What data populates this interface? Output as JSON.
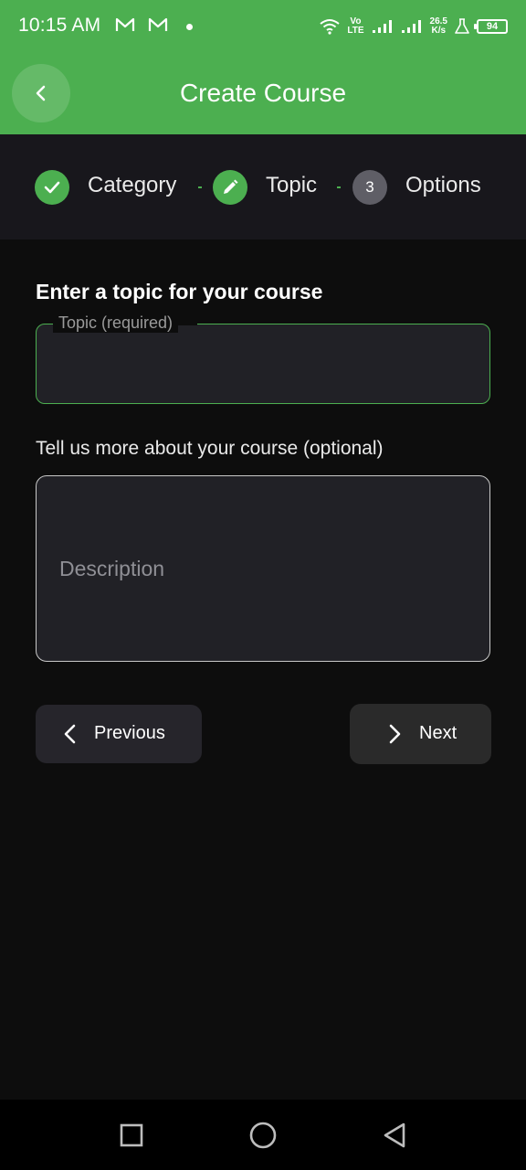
{
  "status_bar": {
    "time": "10:15 AM",
    "network_top": "Vo",
    "network_bottom": "LTE",
    "speed_value": "26.5",
    "speed_unit": "K/s",
    "battery": "94",
    "icons": [
      "gmail-icon",
      "gmail-icon",
      "notification-dot",
      "wifi-icon",
      "volte-icon",
      "signal-icon",
      "signal-icon",
      "speed-indicator",
      "flask-icon",
      "battery-icon"
    ]
  },
  "app_bar": {
    "title": "Create Course",
    "back_icon": "chevron-left-icon",
    "color": "#4caf50"
  },
  "stepper": {
    "steps": [
      {
        "label": "Category",
        "state": "completed",
        "icon": "check-icon"
      },
      {
        "label": "Topic",
        "state": "editing",
        "icon": "pencil-icon"
      },
      {
        "label": "Options",
        "state": "pending",
        "number": "3"
      }
    ]
  },
  "form": {
    "heading": "Enter a topic for your course",
    "topic_label": "Topic (required)",
    "topic_value": "",
    "description_heading": "Tell us more about your course (optional)",
    "description_placeholder": "Description",
    "description_value": ""
  },
  "actions": {
    "previous_label": "Previous",
    "next_label": "Next"
  },
  "nav_bar": {
    "icons": [
      "recents-square-icon",
      "home-circle-icon",
      "back-triangle-icon"
    ]
  },
  "colors": {
    "accent": "#4caf50",
    "background": "#0d0d0d",
    "surface": "#212126"
  }
}
